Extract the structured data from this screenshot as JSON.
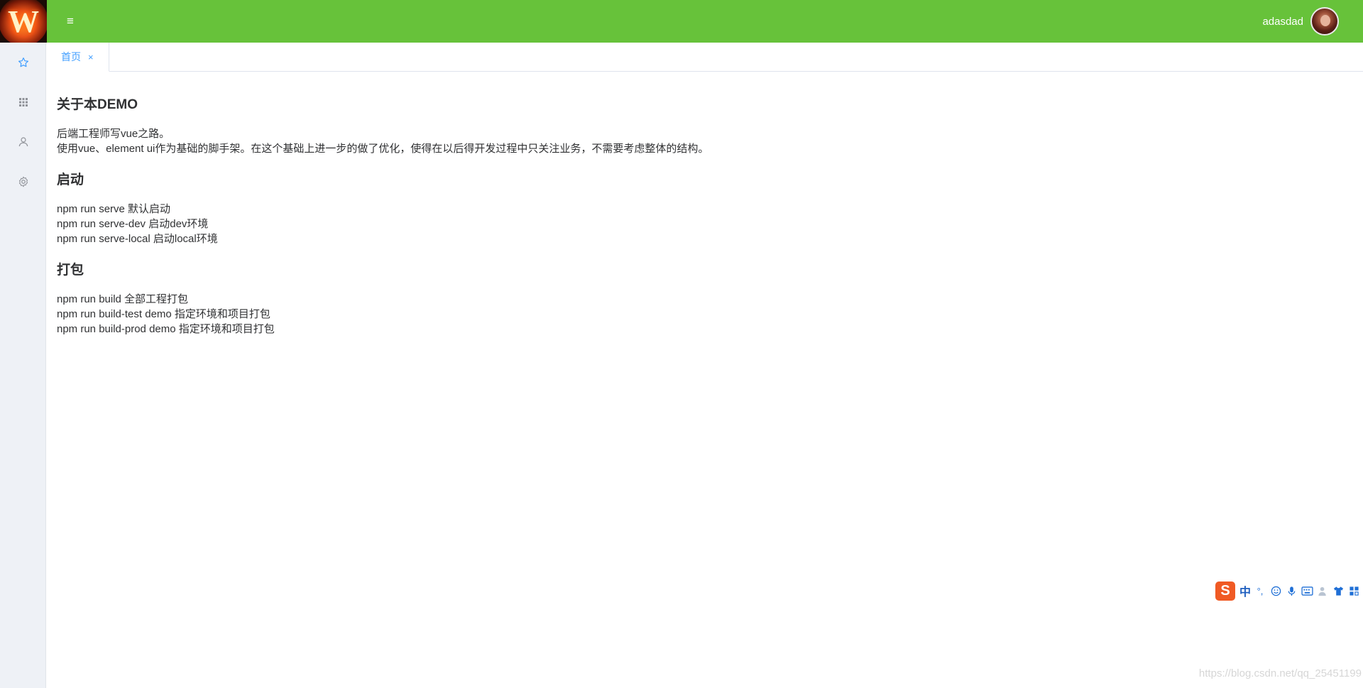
{
  "header": {
    "logo_letter": "W",
    "menu_toggle_glyph": "≡",
    "username": "adasdad",
    "bg_color": "#67c23a"
  },
  "sidebar": {
    "items": [
      {
        "icon": "star-icon"
      },
      {
        "icon": "grid-icon"
      },
      {
        "icon": "user-icon"
      },
      {
        "icon": "gear-icon"
      }
    ]
  },
  "tabs": [
    {
      "label": "首页",
      "close_glyph": "×",
      "active": true
    }
  ],
  "content": {
    "about_title": "关于本DEMO",
    "about_lines": [
      "后端工程师写vue之路。",
      "使用vue、element ui作为基础的脚手架。在这个基础上进一步的做了优化，使得在以后得开发过程中只关注业务，不需要考虑整体的结构。"
    ],
    "start_title": "启动",
    "start_lines": [
      "npm run serve 默认启动",
      "npm run serve-dev 启动dev环境",
      "npm run serve-local 启动local环境"
    ],
    "build_title": "打包",
    "build_lines": [
      "npm run build 全部工程打包",
      "npm run build-test demo 指定环境和项目打包",
      "npm run build-prod demo 指定环境和项目打包"
    ]
  },
  "ime_toolbar": {
    "logo_letter": "S",
    "mode_label": "中",
    "punct_glyph": "°,"
  },
  "watermark": "https://blog.csdn.net/qq_25451199"
}
